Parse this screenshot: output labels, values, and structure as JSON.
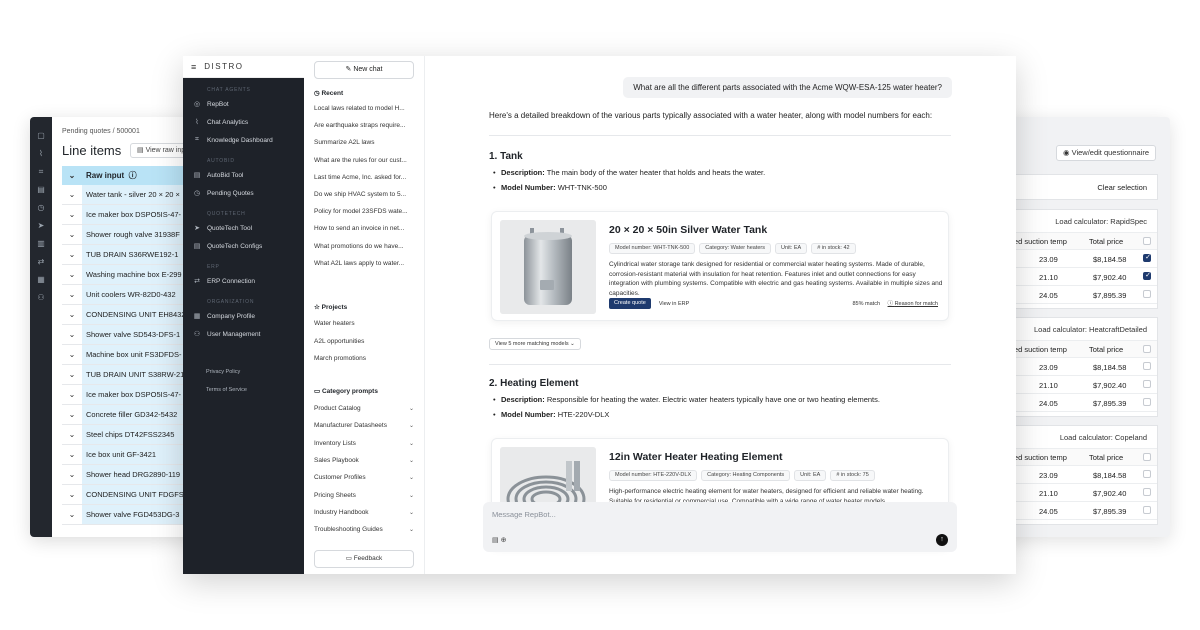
{
  "left_window": {
    "breadcrumb": "Pending quotes / 500001",
    "title": "Line items",
    "raw_button": "View raw inp",
    "header": "Raw input",
    "rows": [
      "Water tank - silver 20 × 20 ×",
      "Ice maker box DSPO5IS-47-",
      "Shower rough valve 31938F",
      "TUB DRAIN S36RWE192-1",
      "Washing machine box E-299",
      "Unit coolers WR-82D0-432",
      "CONDENSING UNIT EH8432",
      "Shower valve SD543-DFS-1",
      "Machine box unit FS3DFDS-",
      "TUB DRAIN UNIT S38RW-21",
      "Ice maker box DSPO5IS-47-",
      "Concrete filler GD342-5432",
      "Steel chips DT42FSS2345",
      "Ice box unit GF-3421",
      "Shower head DRG2890-119",
      "CONDENSING UNIT FDGFS-",
      "Shower valve FGD453DG-3"
    ]
  },
  "right_window": {
    "questionnaire_button": "View/edit questionnaire",
    "clear_selection": "Clear selection",
    "calculators": [
      {
        "label": "Load calculator: RapidSpec",
        "col1": "urated suction temp",
        "col2": "Total price",
        "rows": [
          {
            "temp": "23.09",
            "price": "$8,184.58",
            "checked": true
          },
          {
            "temp": "21.10",
            "price": "$7,902.40",
            "checked": true
          },
          {
            "temp": "24.05",
            "price": "$7,895.39",
            "checked": false
          }
        ]
      },
      {
        "label": "Load calculator: HeatcraftDetailed",
        "col1": "urated suction temp",
        "col2": "Total price",
        "rows": [
          {
            "temp": "23.09",
            "price": "$8,184.58",
            "checked": false
          },
          {
            "temp": "21.10",
            "price": "$7,902.40",
            "checked": false
          },
          {
            "temp": "24.05",
            "price": "$7,895.39",
            "checked": false
          }
        ]
      },
      {
        "label": "Load calculator: Copeland",
        "col1": "urated suction temp",
        "col2": "Total price",
        "rows": [
          {
            "temp": "23.09",
            "price": "$8,184.58",
            "checked": false
          },
          {
            "temp": "21.10",
            "price": "$7,902.40",
            "checked": false
          },
          {
            "temp": "24.05",
            "price": "$7,895.39",
            "checked": false
          }
        ]
      }
    ]
  },
  "sidebar": {
    "brand": "DISTRO",
    "sections": [
      {
        "title": "CHAT AGENTS",
        "items": [
          {
            "label": "RepBot",
            "icon": "bot-icon"
          },
          {
            "label": "Chat Analytics",
            "icon": "chart-icon"
          },
          {
            "label": "Knowledge Dashboard",
            "icon": "grid-icon"
          }
        ]
      },
      {
        "title": "AUTOBID",
        "items": [
          {
            "label": "AutoBid Tool",
            "icon": "doc-icon"
          },
          {
            "label": "Pending Quotes",
            "icon": "clock-icon"
          }
        ]
      },
      {
        "title": "QUOTETECH",
        "items": [
          {
            "label": "QuoteTech Tool",
            "icon": "send-icon"
          },
          {
            "label": "QuoteTech Configs",
            "icon": "doc-icon"
          }
        ]
      },
      {
        "title": "ERP",
        "items": [
          {
            "label": "ERP Connection",
            "icon": "link-icon"
          }
        ]
      },
      {
        "title": "ORGANIZATION",
        "items": [
          {
            "label": "Company Profile",
            "icon": "building-icon"
          },
          {
            "label": "User Management",
            "icon": "users-icon"
          }
        ]
      }
    ],
    "footer_links": [
      "Privacy Policy",
      "Terms of Service"
    ]
  },
  "chat_panel": {
    "new_chat": "New chat",
    "recent_title": "Recent",
    "recent": [
      "Local laws related to model H...",
      "Are earthquake straps require...",
      "Summarize A2L laws",
      "What are the rules for our cust...",
      "Last time Acme, Inc. asked for...",
      "Do we ship HVAC system to 5...",
      "Policy for model 23SFDS wate...",
      "How to send an invoice in net...",
      "What promotions do we have...",
      "What A2L laws apply to water..."
    ],
    "projects_title": "Projects",
    "projects": [
      "Water heaters",
      "A2L opportunities",
      "March promotions"
    ],
    "category_title": "Category prompts",
    "categories": [
      "Product Catalog",
      "Manufacturer Datasheets",
      "Inventory Lists",
      "Sales Playbook",
      "Customer Profiles",
      "Pricing Sheets",
      "Industry Handbook",
      "Troubleshooting Guides"
    ],
    "feedback": "Feedback"
  },
  "chat": {
    "user_message": "What are all the different parts associated with the Acme WQW-ESA-125 water heater?",
    "intro": "Here's a detailed breakdown of the various parts typically associated with a water heater, along with model numbers for each:",
    "sections": [
      {
        "heading": "1. Tank",
        "desc_label": "Description:",
        "desc": "The main body of the water heater that holds and heats the water.",
        "model_label": "Model Number:",
        "model": "WHT-TNK-500",
        "card": {
          "title": "20 × 20 × 50in Silver Water Tank",
          "chips": [
            "Model number: WHT-TNK-500",
            "Category: Water heaters",
            "Unit: EA",
            "# in stock: 42"
          ],
          "description": "Cylindrical water storage tank designed for residential or commercial water heating systems. Made of durable, corrosion-resistant material with insulation for heat retention. Features inlet and outlet connections for easy integration with plumbing systems. Compatible with electric and gas heating systems. Available in multiple sizes and capacities.",
          "create_quote": "Create quote",
          "view_erp": "View in ERP",
          "match": "85% match",
          "reason": "Reason for match"
        }
      },
      {
        "heading": "2. Heating Element",
        "desc_label": "Description:",
        "desc": "Responsible for heating the water. Electric water heaters typically have one or two heating elements.",
        "model_label": "Model Number:",
        "model": "HTE-220V-DLX",
        "card": {
          "title": "12in Water Heater Heating Element",
          "chips": [
            "Model number: HTE-220V-DLX",
            "Category: Heating Components",
            "Unit: EA",
            "# in stock: 75"
          ],
          "description": "High-performance electric heating element for water heaters, designed for efficient and reliable water heating. Suitable for residential or commercial use. Compatible with a wide range of water heater models."
        }
      }
    ],
    "more_models": "View 5 more matching models",
    "composer_placeholder": "Message RepBot..."
  }
}
